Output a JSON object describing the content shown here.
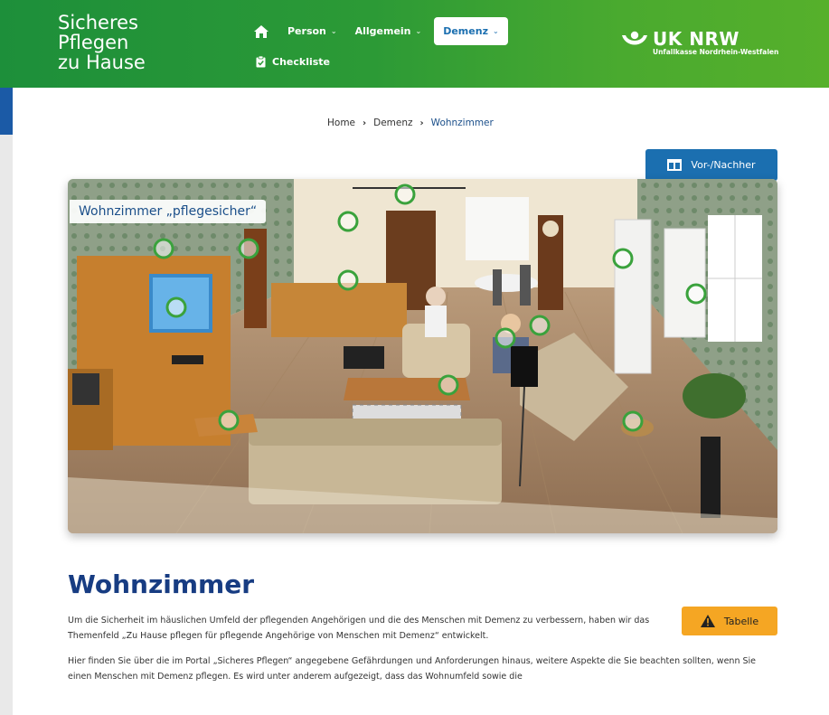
{
  "header": {
    "site_title_lines": [
      "Sicheres",
      "Pflegen",
      "zu Hause"
    ],
    "nav": [
      {
        "label": "Person"
      },
      {
        "label": "Allgemein"
      },
      {
        "label": "Demenz"
      }
    ],
    "checklist_label": "Checkliste",
    "brand": "UK NRW",
    "brand_sub": "Unfallkasse Nordrhein-Westfalen",
    "colors": {
      "green_start": "#1d8f3a",
      "green_end": "#56b02b"
    }
  },
  "breadcrumb": {
    "home": "Home",
    "level2": "Demenz",
    "current": "Wohnzimmer"
  },
  "compare_button": {
    "label": "Vor-/Nachher",
    "color": "#1b6fb0"
  },
  "scene": {
    "label": "Wohnzimmer „pflegesicher“"
  },
  "content": {
    "heading": "Wohnzimmer",
    "table_button": "Tabelle",
    "table_button_color": "#f5a623",
    "paragraph1": "Um die Sicherheit im häuslichen Umfeld der pflegenden Angehörigen und die des Menschen mit Demenz zu verbessern, haben wir das Themenfeld „Zu Hause pflegen für pflegende Angehörige von Menschen mit Demenz“ entwickelt.",
    "paragraph2": "Hier finden Sie über die im Portal „Sicheres Pflegen“ angegebene Gefährdungen und Anforderungen hinaus, weitere Aspekte die Sie beachten sollten, wenn Sie einen Menschen mit Demenz pflegen. Es wird unter anderem aufgezeigt, dass das Wohnumfeld sowie die"
  }
}
